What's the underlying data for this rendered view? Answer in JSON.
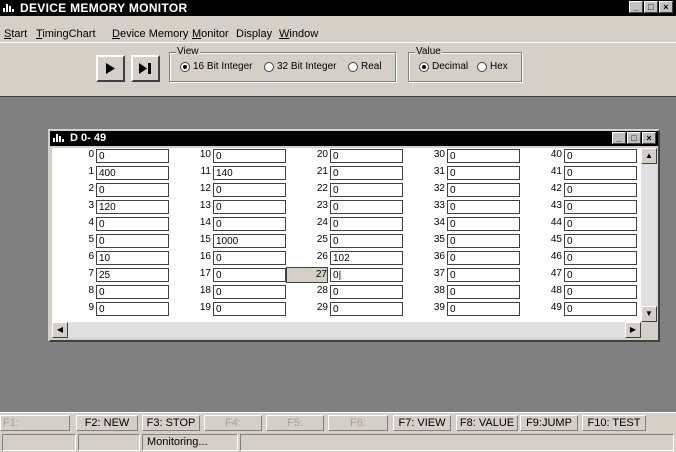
{
  "window": {
    "title": "DEVICE MEMORY MONITOR"
  },
  "menu": {
    "items": [
      {
        "label": "Start",
        "underline": "S"
      },
      {
        "label": "TimingChart",
        "underline": "T"
      },
      {
        "label": "Device Memory",
        "underline": "D"
      },
      {
        "label": "Monitor",
        "underline": "M"
      },
      {
        "label": "Display",
        "underline": ""
      },
      {
        "label": "Window",
        "underline": "W"
      }
    ]
  },
  "toolbar": {
    "view_group_title": "View",
    "view_options": [
      {
        "label": "16 Bit Integer",
        "selected": true
      },
      {
        "label": "32 Bit Integer",
        "selected": false
      },
      {
        "label": "Real",
        "selected": false
      }
    ],
    "value_group_title": "Value",
    "value_options": [
      {
        "label": "Decimal",
        "selected": true
      },
      {
        "label": "Hex",
        "selected": false
      }
    ]
  },
  "child_window": {
    "title": "D  0- 49",
    "columns": [
      {
        "rows": [
          {
            "address": "0",
            "value": "0"
          },
          {
            "address": "1",
            "value": "400"
          },
          {
            "address": "2",
            "value": "0"
          },
          {
            "address": "3",
            "value": "120"
          },
          {
            "address": "4",
            "value": "0"
          },
          {
            "address": "5",
            "value": "0"
          },
          {
            "address": "6",
            "value": "10"
          },
          {
            "address": "7",
            "value": "25"
          },
          {
            "address": "8",
            "value": "0"
          },
          {
            "address": "9",
            "value": "0"
          }
        ]
      },
      {
        "rows": [
          {
            "address": "10",
            "value": "0"
          },
          {
            "address": "11",
            "value": "140"
          },
          {
            "address": "12",
            "value": "0"
          },
          {
            "address": "13",
            "value": "0"
          },
          {
            "address": "14",
            "value": "0"
          },
          {
            "address": "15",
            "value": "1000"
          },
          {
            "address": "16",
            "value": "0"
          },
          {
            "address": "17",
            "value": "0"
          },
          {
            "address": "18",
            "value": "0"
          },
          {
            "address": "19",
            "value": "0"
          }
        ]
      },
      {
        "rows": [
          {
            "address": "20",
            "value": "0"
          },
          {
            "address": "21",
            "value": "0"
          },
          {
            "address": "22",
            "value": "0"
          },
          {
            "address": "23",
            "value": "0"
          },
          {
            "address": "24",
            "value": "0"
          },
          {
            "address": "25",
            "value": "0"
          },
          {
            "address": "26",
            "value": "102"
          },
          {
            "address": "27",
            "value": "0",
            "editing": true
          },
          {
            "address": "28",
            "value": "0"
          },
          {
            "address": "29",
            "value": "0"
          }
        ]
      },
      {
        "rows": [
          {
            "address": "30",
            "value": "0"
          },
          {
            "address": "31",
            "value": "0"
          },
          {
            "address": "32",
            "value": "0"
          },
          {
            "address": "33",
            "value": "0"
          },
          {
            "address": "34",
            "value": "0"
          },
          {
            "address": "35",
            "value": "0"
          },
          {
            "address": "36",
            "value": "0"
          },
          {
            "address": "37",
            "value": "0"
          },
          {
            "address": "38",
            "value": "0"
          },
          {
            "address": "39",
            "value": "0"
          }
        ]
      },
      {
        "rows": [
          {
            "address": "40",
            "value": "0"
          },
          {
            "address": "41",
            "value": "0"
          },
          {
            "address": "42",
            "value": "0"
          },
          {
            "address": "43",
            "value": "0"
          },
          {
            "address": "44",
            "value": "0"
          },
          {
            "address": "45",
            "value": "0"
          },
          {
            "address": "46",
            "value": "0"
          },
          {
            "address": "47",
            "value": "0"
          },
          {
            "address": "48",
            "value": "0"
          },
          {
            "address": "49",
            "value": "0"
          }
        ]
      }
    ]
  },
  "function_keys": [
    {
      "label": "F1:",
      "enabled": false
    },
    {
      "label": "F2: NEW",
      "enabled": true
    },
    {
      "label": "F3: STOP",
      "enabled": true
    },
    {
      "label": "F4:",
      "enabled": false
    },
    {
      "label": "F5:",
      "enabled": false
    },
    {
      "label": "F6:",
      "enabled": false
    },
    {
      "label": "F7: VIEW",
      "enabled": true
    },
    {
      "label": "F8: VALUE",
      "enabled": true
    },
    {
      "label": "F9:JUMP",
      "enabled": true
    },
    {
      "label": "F10: TEST",
      "enabled": true
    }
  ],
  "status": {
    "text": "Monitoring..."
  },
  "colors": {
    "face": "#d4d0c8",
    "workspace": "#808080",
    "titlebar": "#000000"
  }
}
